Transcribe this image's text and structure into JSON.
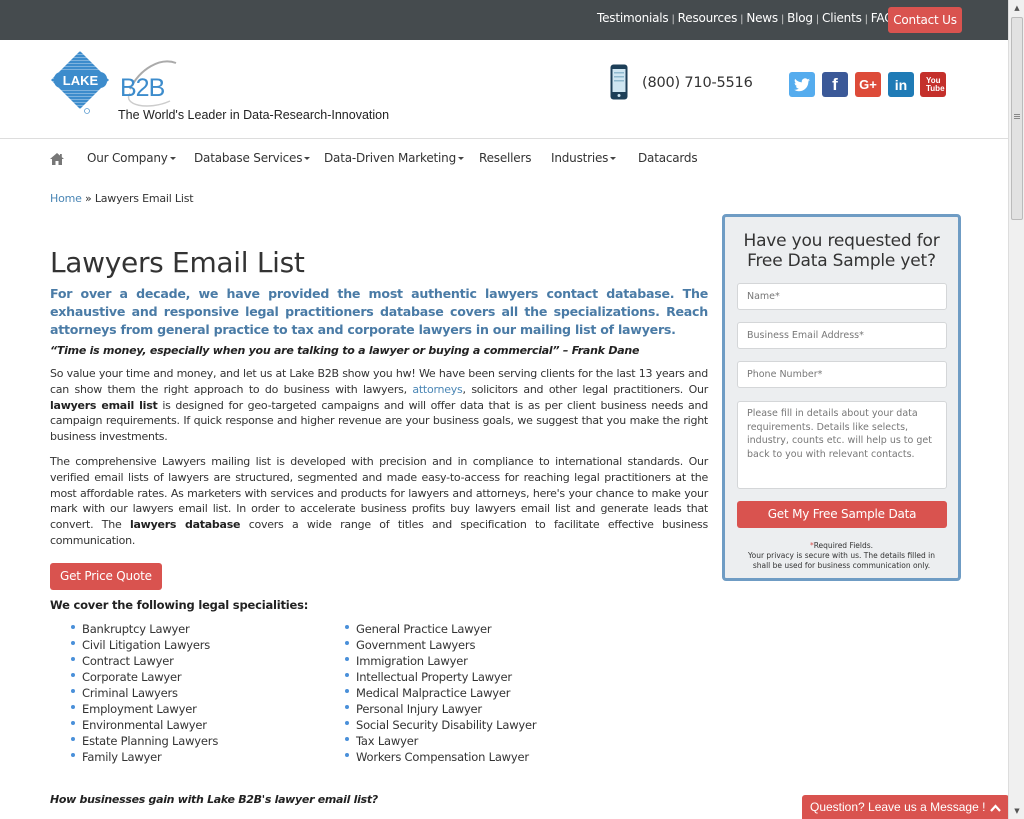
{
  "topbar": {
    "links": [
      "Testimonials",
      "Resources",
      "News",
      "Blog",
      "Clients",
      "FAQs"
    ],
    "separator": "|",
    "contact_label": "Contact Us"
  },
  "header": {
    "logo_lake": "LAKE",
    "logo_b2b": "B2B",
    "tagline": "The World's Leader in Data-Research-Innovation",
    "phone": "(800) 710-5516",
    "social": [
      {
        "name": "twitter",
        "glyph": "t",
        "color": "#55acee"
      },
      {
        "name": "facebook",
        "glyph": "f",
        "color": "#3b5998"
      },
      {
        "name": "google-plus",
        "glyph": "G+",
        "color": "#dd4b39"
      },
      {
        "name": "linkedin",
        "glyph": "in",
        "color": "#1f7bb6"
      },
      {
        "name": "youtube",
        "glyph": "You Tube",
        "color": "#c4302b"
      }
    ]
  },
  "nav": {
    "items": [
      {
        "label": "Our Company",
        "dropdown": true
      },
      {
        "label": "Database Services",
        "dropdown": true
      },
      {
        "label": "Data-Driven Marketing",
        "dropdown": true
      },
      {
        "label": "Resellers",
        "dropdown": false
      },
      {
        "label": "Industries",
        "dropdown": true
      },
      {
        "label": "Datacards",
        "dropdown": false
      }
    ]
  },
  "breadcrumb": {
    "home": "Home",
    "sep": "»",
    "current": "Lawyers Email List"
  },
  "main": {
    "title": "Lawyers Email List",
    "lead": "For over a decade, we have provided the most authentic lawyers contact database. The exhaustive and responsive legal practitioners database covers all the specializations. Reach attorneys from general practice to tax and corporate lawyers in our mailing list of lawyers.",
    "quote": "“Time is money, especially when you are talking to a lawyer or buying a commercial” – Frank Dane",
    "para1": {
      "a": "So value your time and money, and let us at Lake B2B show you hw! We have been serving clients for the last 13 years and can show them the right approach to do business with lawyers, ",
      "link": "attorneys",
      "b": ", solicitors and other legal practitioners. Our ",
      "bold": "lawyers email list",
      "c": " is designed for geo-targeted campaigns and will offer data that is as per client business needs and campaign requirements. If quick response and higher revenue are your business goals, we suggest that you make the right business investments."
    },
    "para2": {
      "a": "The comprehensive Lawyers mailing list is developed with precision and in compliance to international standards. Our verified email lists of lawyers are structured, segmented and made easy-to-access for reaching legal practitioners at the most affordable rates. As marketers with services and products for lawyers and attorneys, here's your chance to make your mark with our lawyers email list. In order to accelerate business profits buy lawyers email list and generate leads that convert. The ",
      "bold": "lawyers database",
      "b": " covers a wide range of titles and specification to facilitate effective business communication."
    },
    "quote_button": "Get Price Quote",
    "specialities_title": "We cover the following legal specialities:",
    "specialities_col1": [
      "Bankruptcy Lawyer",
      "Civil Litigation Lawyers",
      "Contract Lawyer",
      "Corporate Lawyer",
      "Criminal Lawyers",
      "Employment Lawyer",
      "Environmental Lawyer",
      "Estate Planning Lawyers",
      "Family Lawyer"
    ],
    "specialities_col2": [
      "General Practice Lawyer",
      "Government Lawyers",
      "Immigration Lawyer",
      "Intellectual Property Lawyer",
      "Medical Malpractice Lawyer",
      "Personal Injury Lawyer",
      "Social Security Disability Lawyer",
      "Tax Lawyer",
      "Workers Compensation Lawyer"
    ],
    "subheading": "How businesses gain with Lake B2B's lawyer email list?"
  },
  "form": {
    "title_line1": "Have you requested for",
    "title_line2": "Free Data Sample yet?",
    "name_placeholder": "Name*",
    "email_placeholder": "Business Email Address*",
    "phone_placeholder": "Phone Number*",
    "details_placeholder": "Please fill in details about your data requirements. Details like selects, industry, counts etc. will help us to get back to you with relevant contacts.",
    "submit_label": "Get My Free Sample Data",
    "required_star": "*",
    "required_text": "Required Fields.",
    "privacy_text": "Your privacy is secure with us. The details filled in shall be used for business communication only."
  },
  "chat": {
    "label": "Question? Leave us a Message !",
    "chevron": "^"
  },
  "colors": {
    "topbar": "#454b4e",
    "accent_red": "#d9534f",
    "lead_blue": "#4a7ba6",
    "link_blue": "#4a86b5",
    "panel_border": "#6f9cc4"
  }
}
